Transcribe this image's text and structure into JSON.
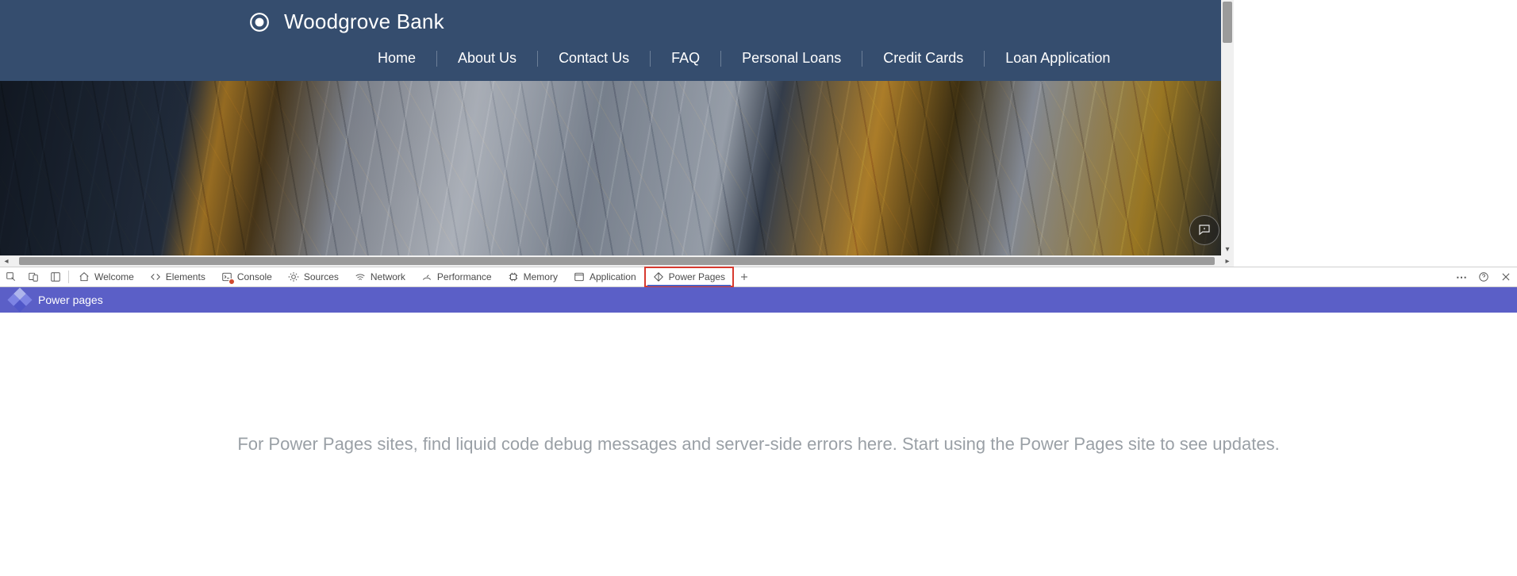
{
  "site": {
    "brand": "Woodgrove Bank",
    "nav": [
      "Home",
      "About Us",
      "Contact Us",
      "FAQ",
      "Personal Loans",
      "Credit Cards",
      "Loan Application"
    ]
  },
  "devtools": {
    "icon_buttons": {
      "inspect": "inspect",
      "device": "device-toolbar",
      "activity": "activity-bar"
    },
    "tabs": [
      {
        "id": "welcome",
        "label": "Welcome",
        "icon": "home"
      },
      {
        "id": "elements",
        "label": "Elements",
        "icon": "code"
      },
      {
        "id": "console",
        "label": "Console",
        "icon": "console",
        "status": "warn"
      },
      {
        "id": "sources",
        "label": "Sources",
        "icon": "bug"
      },
      {
        "id": "network",
        "label": "Network",
        "icon": "wifi"
      },
      {
        "id": "performance",
        "label": "Performance",
        "icon": "gauge"
      },
      {
        "id": "memory",
        "label": "Memory",
        "icon": "chip"
      },
      {
        "id": "application",
        "label": "Application",
        "icon": "window"
      },
      {
        "id": "powerpages",
        "label": "Power Pages",
        "icon": "diamond",
        "active": true
      }
    ],
    "right_buttons": {
      "more": "⋯",
      "help": "?",
      "close": "✕"
    },
    "panel": {
      "title": "Power pages",
      "empty": "For Power Pages sites, find liquid code debug messages and server-side errors here. Start using the Power Pages site to see updates."
    }
  }
}
